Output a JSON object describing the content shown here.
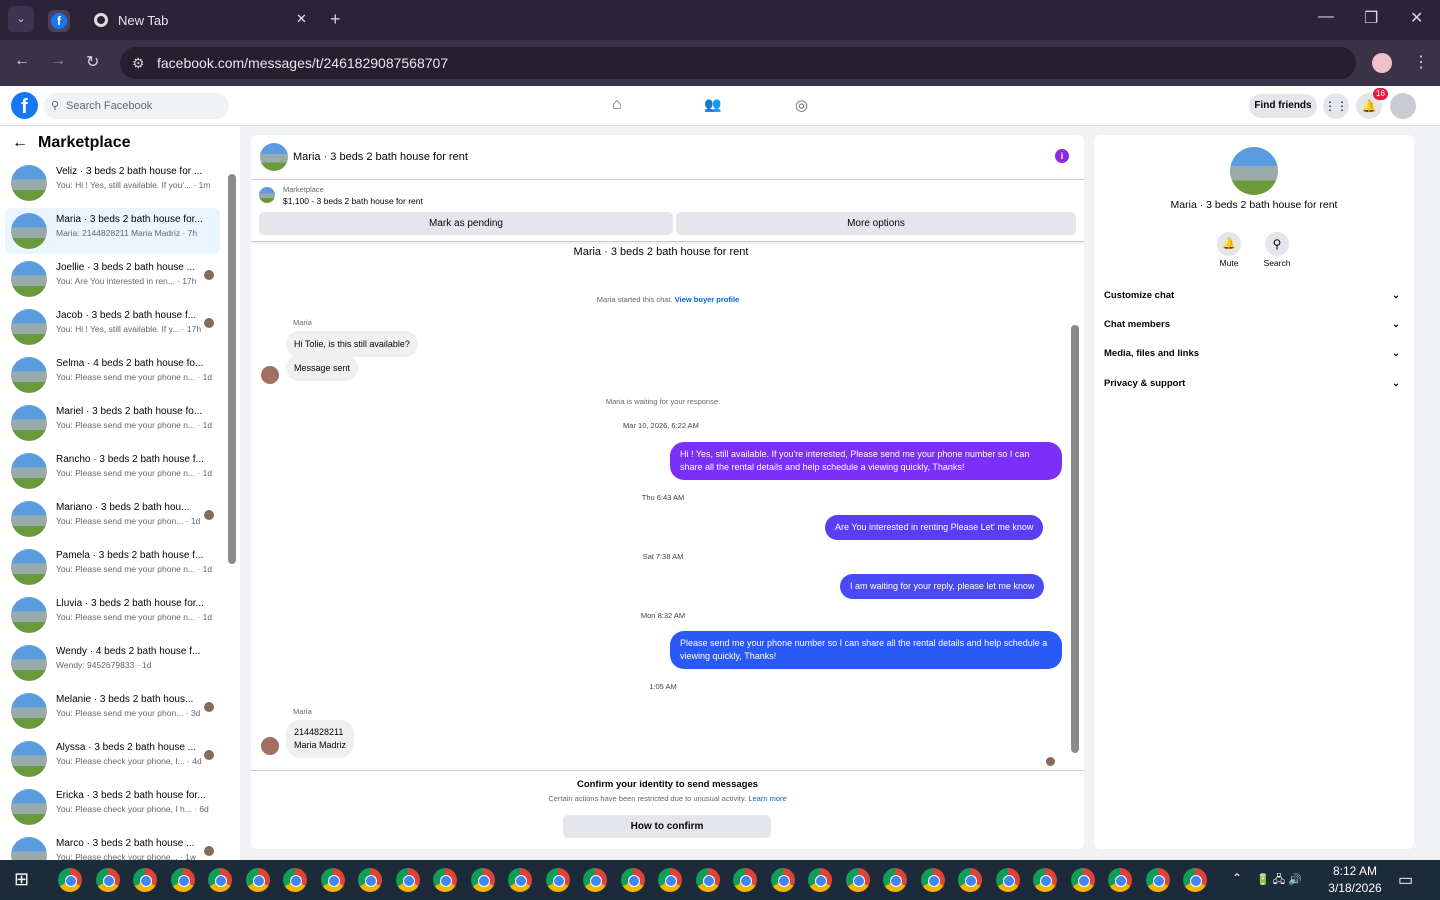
{
  "browser": {
    "tab_title": "New Tab",
    "url": "facebook.com/messages/t/2461829087568707"
  },
  "facebook": {
    "search_placeholder": "Search Facebook",
    "find_friends": "Find friends",
    "notification_count": "16"
  },
  "sidebar": {
    "title": "Marketplace",
    "conversations": [
      {
        "title": "Veliz · 3 beds 2 bath house for ...",
        "snippet": "You: Hi ! Yes, still available. If you'... · 1m",
        "selected": false
      },
      {
        "title": "Maria · 3 beds 2 bath house for...",
        "snippet": "Maria: 2144828211 Maria Madriz · 7h",
        "selected": true
      },
      {
        "title": "Joellie · 3 beds 2 bath house ...",
        "snippet": "You: Are You interested in ren... · 17h",
        "selected": false
      },
      {
        "title": "Jacob · 3 beds 2 bath house f...",
        "snippet": "You: Hi ! Yes, still available. If y... · 17h",
        "selected": false
      },
      {
        "title": "Selma · 4 beds 2 bath house fo...",
        "snippet": "You: Please send me your phone n... · 1d",
        "selected": false
      },
      {
        "title": "Mariel · 3 beds 2 bath house fo...",
        "snippet": "You: Please send me your phone n... · 1d",
        "selected": false
      },
      {
        "title": "Rancho · 3 beds 2 bath house f...",
        "snippet": "You: Please send me your phone n... · 1d",
        "selected": false
      },
      {
        "title": "Mariano · 3 beds 2 bath hou...",
        "snippet": "You: Please send me your phon... · 1d",
        "selected": false
      },
      {
        "title": "Pamela · 3 beds 2 bath house f...",
        "snippet": "You: Please send me your phone n... · 1d",
        "selected": false
      },
      {
        "title": "Lluvia · 3 beds 2 bath house for...",
        "snippet": "You: Please send me your phone n... · 1d",
        "selected": false
      },
      {
        "title": "Wendy · 4 beds 2 bath house f...",
        "snippet": "Wendy: 9452679833 · 1d",
        "selected": false
      },
      {
        "title": "Melanie · 3 beds 2 bath hous...",
        "snippet": "You: Please send me your phon... · 3d",
        "selected": false
      },
      {
        "title": "Alyssa · 3 beds 2 bath house ...",
        "snippet": "You: Please check your phone, I... · 4d",
        "selected": false
      },
      {
        "title": "Ericka · 3 beds 2 bath house for...",
        "snippet": "You: Please check your phone, I h... · 6d",
        "selected": false
      },
      {
        "title": "Marco · 3 beds 2 bath house ...",
        "snippet": "You: Please check your phone... · 1w",
        "selected": false
      }
    ]
  },
  "chat": {
    "title": "Maria · 3 beds 2 bath house for rent",
    "listing_label": "Marketplace",
    "listing": "$1,100 - 3 beds 2 bath house for rent",
    "mark_pending": "Mark as pending",
    "more_options": "More options",
    "cut_title": "Maria · 3 beds 2 bath house for rent",
    "started": "Maria started this chat.",
    "view_profile": "View buyer profile",
    "sender": "Maria",
    "msg1": "Hi Tolie, is this still available?",
    "msg2": "Message sent",
    "waiting": "Maria is waiting for your response.",
    "ts1": "Mar 10, 2026, 6:22 AM",
    "out1": "Hi ! Yes, still available. If you're interested, Please send me your phone number so I can share all the rental details and help schedule a viewing quickly, Thanks!",
    "ts2": "Thu 6:43 AM",
    "out2": "Are You  interested in renting Please Let' me know",
    "ts3": "Sat 7:38 AM",
    "out3": "I am waiting for your reply, please let me know",
    "ts4": "Mon 8:32 AM",
    "out4": "Please send me your phone number so I can share all the rental details and help schedule a viewing quickly, Thanks!",
    "ts5": "1:05 AM",
    "sender2": "Maria",
    "in3a": "2144828211",
    "in3b": "Maria Madriz",
    "confirm_title": "Confirm your identity to send messages",
    "confirm_text": "Certain actions have been restricted due to unusual activity.",
    "learn_more": "Learn more",
    "how_confirm": "How to confirm"
  },
  "info": {
    "title": "Maria · 3 beds 2 bath house for rent",
    "mute": "Mute",
    "search": "Search",
    "sections": [
      "Customize chat",
      "Chat members",
      "Media, files and links",
      "Privacy & support"
    ]
  },
  "taskbar": {
    "time": "8:12 AM",
    "date": "3/18/2026"
  }
}
